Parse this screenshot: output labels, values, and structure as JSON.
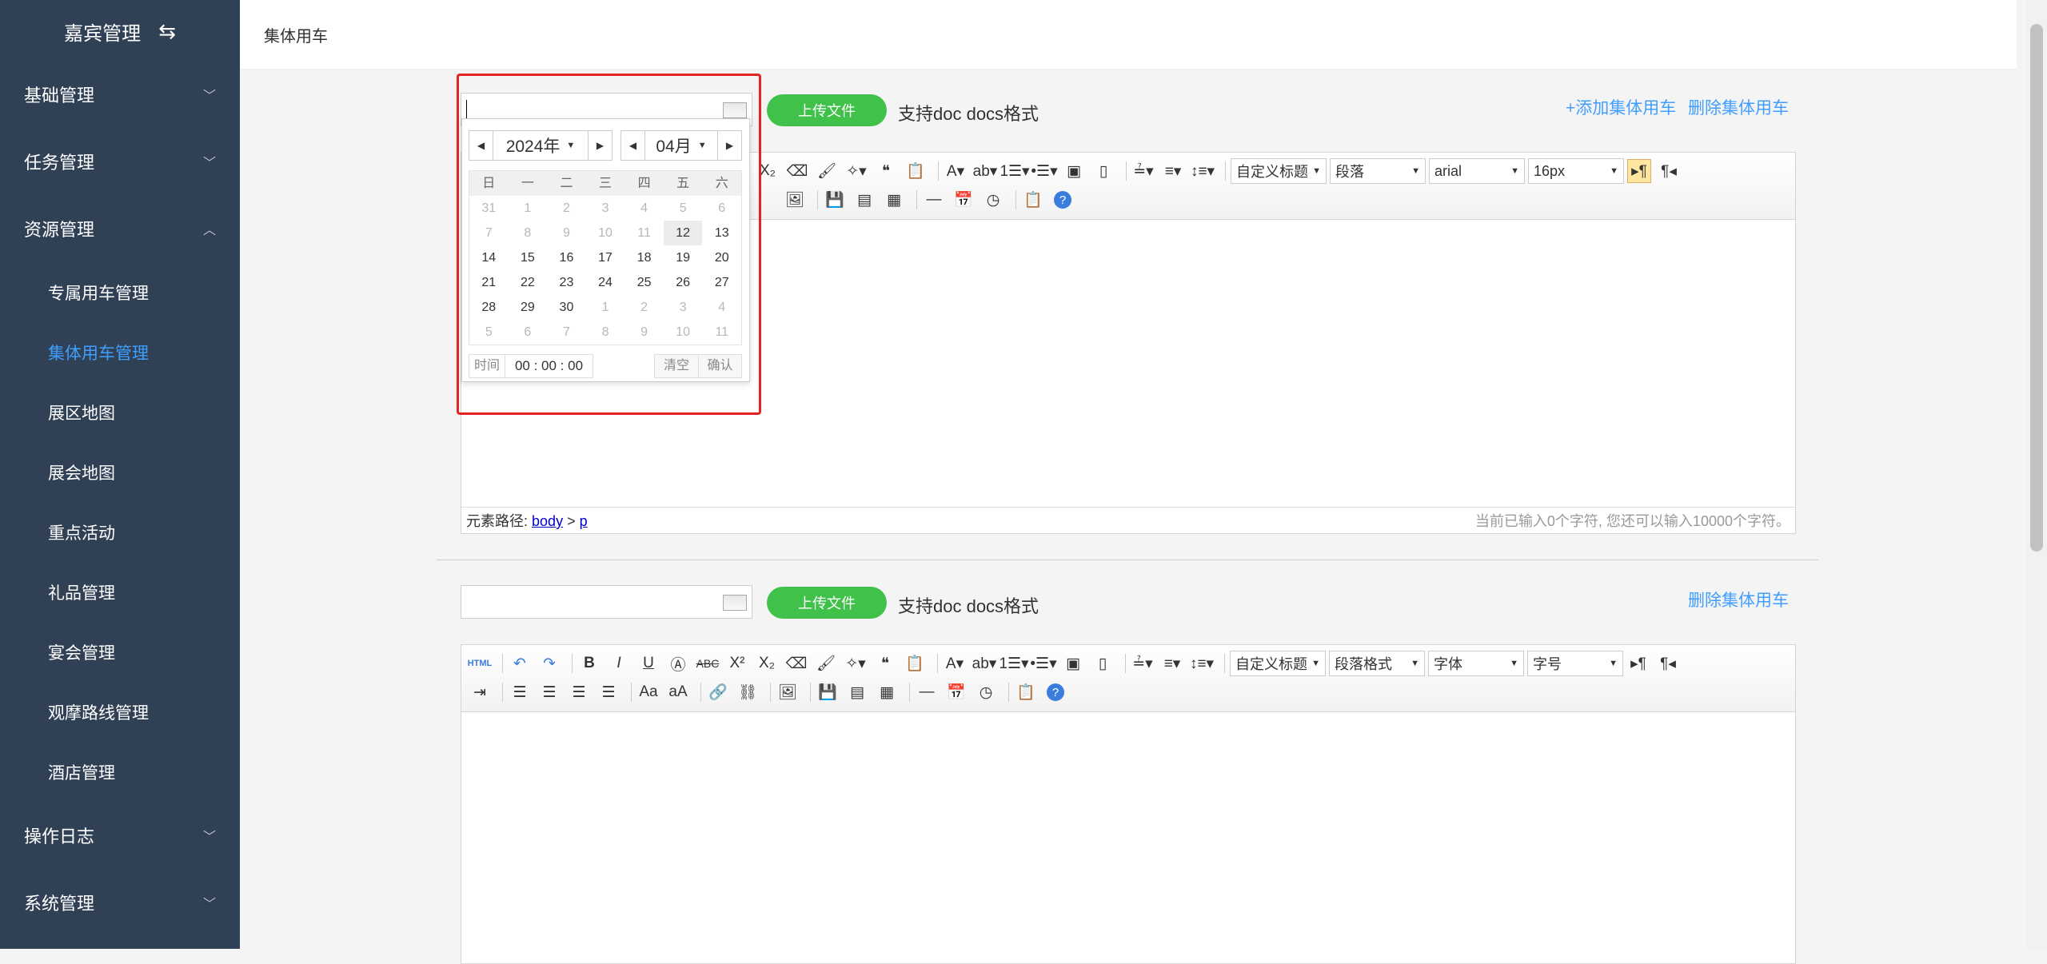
{
  "sidebar": {
    "title": "嘉宾管理",
    "groups": [
      {
        "label": "基础管理"
      },
      {
        "label": "任务管理"
      },
      {
        "label": "资源管理"
      },
      {
        "label": "操作日志"
      },
      {
        "label": "系统管理"
      }
    ],
    "items": [
      {
        "label": "专属用车管理"
      },
      {
        "label": "集体用车管理"
      },
      {
        "label": "展区地图"
      },
      {
        "label": "展会地图"
      },
      {
        "label": "重点活动"
      },
      {
        "label": "礼品管理"
      },
      {
        "label": "宴会管理"
      },
      {
        "label": "观摩路线管理"
      },
      {
        "label": "酒店管理"
      }
    ]
  },
  "header": {
    "breadcrumb": "集体用车"
  },
  "row1": {
    "upload_label": "上传文件",
    "hint": "支持doc docs格式",
    "add_link": "+添加集体用车",
    "delete_link": "删除集体用车"
  },
  "row2": {
    "upload_label": "上传文件",
    "hint": "支持doc docs格式",
    "delete_link": "删除集体用车"
  },
  "editor1": {
    "custom_title": "自定义标题",
    "paragraph": "段落",
    "font": "arial",
    "size": "16px",
    "path_label": "元素路径:",
    "path_body": "body",
    "path_sep": ">",
    "path_p": "p",
    "char_count": "当前已输入0个字符, 您还可以输入10000个字符。"
  },
  "editor2": {
    "custom_title": "自定义标题",
    "paragraph": "段落格式",
    "font": "字体",
    "size": "字号",
    "html_label": "HTML"
  },
  "datepicker": {
    "year": "2024年",
    "month": "04月",
    "weekdays": [
      "日",
      "一",
      "二",
      "三",
      "四",
      "五",
      "六"
    ],
    "weeks": [
      [
        "31",
        "1",
        "2",
        "3",
        "4",
        "5",
        "6"
      ],
      [
        "7",
        "8",
        "9",
        "10",
        "11",
        "12",
        "13"
      ],
      [
        "14",
        "15",
        "16",
        "17",
        "18",
        "19",
        "20"
      ],
      [
        "21",
        "22",
        "23",
        "24",
        "25",
        "26",
        "27"
      ],
      [
        "28",
        "29",
        "30",
        "1",
        "2",
        "3",
        "4"
      ],
      [
        "5",
        "6",
        "7",
        "8",
        "9",
        "10",
        "11"
      ]
    ],
    "time_label": "时间",
    "time_value": "00 : 00 : 00",
    "clear_label": "清空",
    "confirm_label": "确认"
  }
}
